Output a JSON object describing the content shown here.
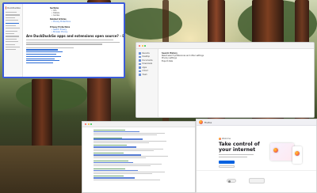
{
  "help_window": {
    "sidebar_brand": "DuckDuckGo",
    "page_title": "Are DuckDuckGo apps and extensions open source? - DuckDuckGo Help Pages",
    "top_lines": [
      "Sections",
      "Info",
      "Details",
      "Guides"
    ],
    "related_heading": "Related Articles",
    "related_link": "Privacy Protections",
    "desc_heading": "Privacy Protections",
    "desc_links": [
      "Search Privacy",
      "Browser Privacy"
    ]
  },
  "finder_window": {
    "sidebar_items": [
      "Recents",
      "Desktop",
      "Documents",
      "Downloads",
      "Apps",
      "iCloud",
      "Trash"
    ],
    "pane_heading": "Search History",
    "pane_lines": [
      "Reset search preferences and other settings",
      "Privacy settings",
      "Export data"
    ]
  },
  "firefox_window": {
    "brand": "Firefox",
    "kicker": "Welcome",
    "heading": "Take control of your internet"
  },
  "colors": {
    "help_window_border": "#3b5bdb",
    "duckduckgo_orange": "#de5833",
    "firefox_blue": "#0061e0"
  }
}
